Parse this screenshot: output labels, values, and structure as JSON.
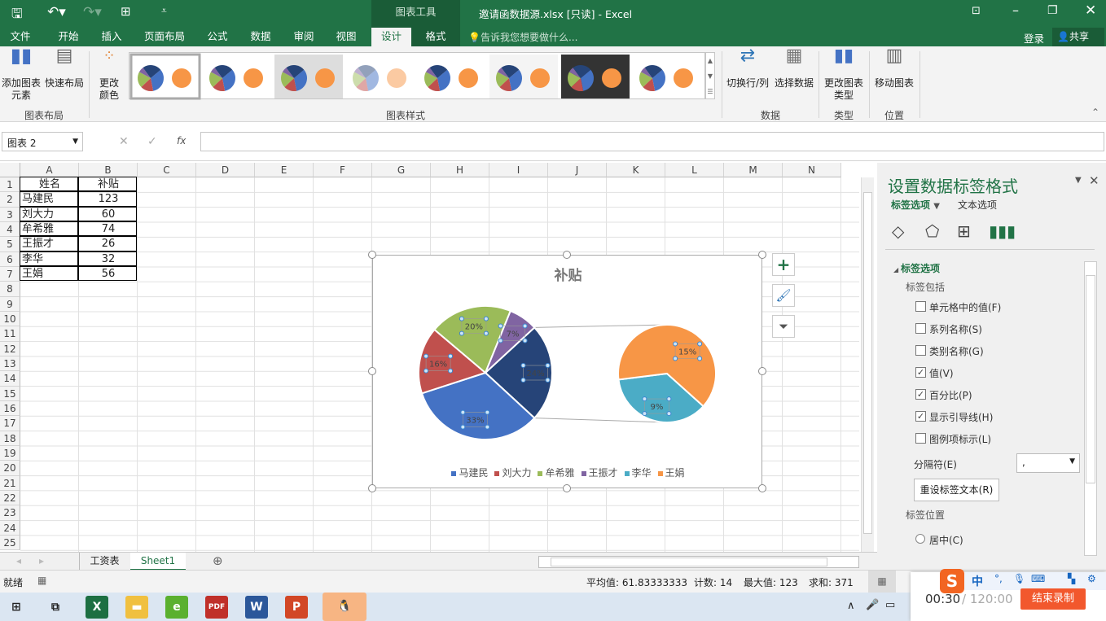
{
  "titlebar": {
    "context_tool": "图表工具",
    "doc_title": "邀请函数据源.xlsx  [只读] - Excel"
  },
  "tabs": [
    "文件",
    "开始",
    "插入",
    "页面布局",
    "公式",
    "数据",
    "审阅",
    "视图",
    "设计",
    "格式"
  ],
  "active_tab": "设计",
  "tell_me": "告诉我您想要做什么...",
  "login": "登录",
  "share": "共享",
  "ribbon": {
    "add_element": "添加图表元素",
    "quick_layout": "快速布局",
    "change_colors": "更改颜色",
    "group_layout": "图表布局",
    "group_styles": "图表样式",
    "switch_rowcol": "切换行/列",
    "select_data": "选择数据",
    "group_data": "数据",
    "change_type": "更改图表类型",
    "group_type": "类型",
    "move_chart": "移动图表",
    "group_location": "位置"
  },
  "formula": {
    "name_box": "图表 2",
    "fx": "fx",
    "value": ""
  },
  "columns": [
    "A",
    "B",
    "C",
    "D",
    "E",
    "F",
    "G",
    "H",
    "I",
    "J",
    "K",
    "L",
    "M",
    "N"
  ],
  "rows": [
    1,
    2,
    3,
    4,
    5,
    6,
    7,
    8,
    9,
    10,
    11,
    12,
    13,
    14,
    15,
    16,
    17,
    18,
    19,
    20,
    21,
    22,
    23,
    24,
    25
  ],
  "table": {
    "header": [
      "姓名",
      "补贴"
    ],
    "rows": [
      [
        "马建民",
        "123"
      ],
      [
        "刘大力",
        "60"
      ],
      [
        "牟希雅",
        "74"
      ],
      [
        "王振才",
        "26"
      ],
      [
        "李华",
        "32"
      ],
      [
        "王娟",
        "56"
      ]
    ]
  },
  "chart_data": {
    "type": "pie-of-pie",
    "title": "补贴",
    "categories": [
      "马建民",
      "刘大力",
      "牟希雅",
      "王振才",
      "李华",
      "王娟"
    ],
    "values": [
      123,
      60,
      74,
      26,
      32,
      56
    ],
    "colors": [
      "#4472c4",
      "#c0504d",
      "#9bbb59",
      "#8064a2",
      "#4bacc6",
      "#f79646"
    ],
    "other_color": "#264478",
    "main_labels": [
      "33%",
      "16%",
      "20%",
      "7%"
    ],
    "other_label": "24%",
    "secondary_labels": [
      "9%",
      "15%"
    ],
    "legend": "bottom"
  },
  "pane": {
    "title": "设置数据标签格式",
    "tab1": "标签选项",
    "tab2": "文本选项",
    "section": "标签选项",
    "includes": "标签包括",
    "options": [
      {
        "label": "单元格中的值(F)",
        "checked": false
      },
      {
        "label": "系列名称(S)",
        "checked": false
      },
      {
        "label": "类别名称(G)",
        "checked": false
      },
      {
        "label": "值(V)",
        "checked": true
      },
      {
        "label": "百分比(P)",
        "checked": true
      },
      {
        "label": "显示引导线(H)",
        "checked": true
      },
      {
        "label": "图例项标示(L)",
        "checked": false
      }
    ],
    "separator_label": "分隔符(E)",
    "separator_value": ",",
    "reset": "重设标签文本(R)",
    "position": "标签位置",
    "pos_center": "居中(C)"
  },
  "sheets": [
    "工资表",
    "Sheet1"
  ],
  "active_sheet": "Sheet1",
  "status": {
    "ready": "就绪",
    "avg": "平均值: 61.83333333",
    "count": "计数: 14",
    "max": "最大值: 123",
    "sum": "求和: 371"
  },
  "recorder": {
    "time": "00:30",
    "total": " / 120:00",
    "stop": "结束录制",
    "ime": "中"
  }
}
